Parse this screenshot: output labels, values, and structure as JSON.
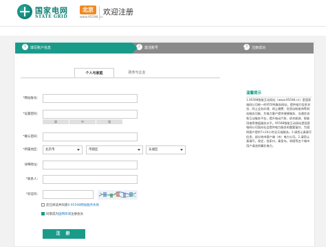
{
  "header": {
    "logo_cn": "国家电网",
    "logo_en": "STATE GRID",
    "city": "北京",
    "city_url": "www.95598.cn",
    "title": "欢迎注册"
  },
  "steps": [
    {
      "num": "1",
      "label": "填写账户信息"
    },
    {
      "num": "2",
      "label": "激活账号"
    },
    {
      "num": "3",
      "label": "注册成功"
    }
  ],
  "tabs": {
    "active": "个人与家庭",
    "inactive": "政务与企业"
  },
  "form": {
    "account_label": "*网站账号：",
    "password_label": "*设置密码：",
    "strength": [
      "弱",
      "中",
      "强"
    ],
    "confirm_label": "*确认密码：",
    "region_label": "*所属地区：",
    "region_province": "北京市",
    "region_city": "市辖区",
    "region_district": "东城区",
    "address_label": "详细地址：",
    "contact_label": "*联系人：",
    "captcha_label": "*验证码：",
    "agree_prefix": "您已阅读并同意",
    "agree_link": "9.95598网站服务条款",
    "member_prefix": "同意成为",
    "member_link": "国网商城",
    "member_suffix": "注册会员",
    "submit": "注 册"
  },
  "tips": {
    "title": "温馨提示",
    "body": "1.95598智能互动网站（www.95598.cn）是国家电网公司统一的95598服务网站，提供电力信息浏览、网上业务办理、网上缴费、信息自助查询等网站服务功能，为电力客户提供便捷服务、沟通交流和互动服务平台，提升电动汽车、综合能源、智能用电等增值服务水平。95598智能互动网站是国家电网公司面向社会提供电力服务的重要窗口，为国网客户提供7×24小时全天候服务。2.请您认真填写信息，部分地市客户端（市）电力公司。2.请您认真填写，保定，张家口，秦皇岛，承德等五个城市用户请选择冀北电力。"
  },
  "colors": {
    "brand": "#1a9b8a",
    "city_badge": "#f08a24",
    "step_inactive": "#8a8a8a",
    "link": "#1a7bc4"
  }
}
